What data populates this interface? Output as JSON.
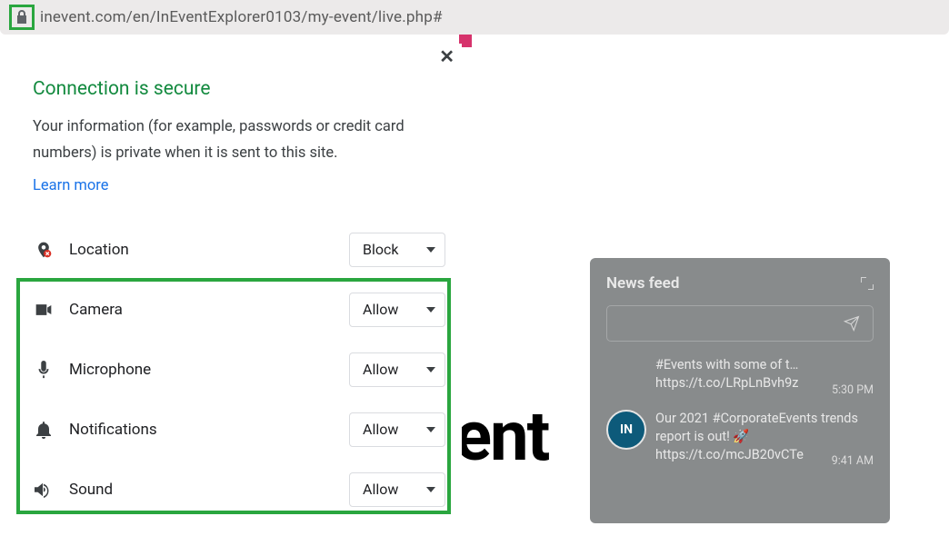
{
  "urlbar": {
    "url": "inevent.com/en/InEventExplorer0103/my-event/live.php#"
  },
  "popup": {
    "title": "Connection is secure",
    "description": "Your information (for example, passwords or credit card numbers) is private when it is sent to this site.",
    "learn_more": "Learn more",
    "permissions": [
      {
        "name": "Location",
        "value": "Block",
        "icon": "location"
      },
      {
        "name": "Camera",
        "value": "Allow",
        "icon": "camera"
      },
      {
        "name": "Microphone",
        "value": "Allow",
        "icon": "microphone"
      },
      {
        "name": "Notifications",
        "value": "Allow",
        "icon": "bell"
      },
      {
        "name": "Sound",
        "value": "Allow",
        "icon": "sound"
      }
    ]
  },
  "background": {
    "partial_text": "ent"
  },
  "news": {
    "title": "News feed",
    "items": [
      {
        "text": "#Events with some of t…",
        "link": "https://t.co/LRpLnBvh9z",
        "time": "5:30 PM"
      },
      {
        "text": "Our 2021 #CorporateEvents trends report is out! 🚀",
        "link": "https://t.co/mcJB20vCTe",
        "time": "9:41 AM"
      }
    ]
  }
}
